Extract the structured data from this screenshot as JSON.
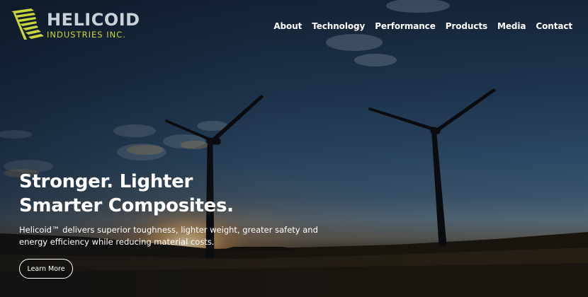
{
  "brand": {
    "name": "HELICOID",
    "tagline": "INDUSTRIES INC.",
    "logo_icon": "helicoid-logo-icon",
    "accent_color": "#c8d63c"
  },
  "nav": {
    "items": [
      {
        "label": "About"
      },
      {
        "label": "Technology"
      },
      {
        "label": "Performance"
      },
      {
        "label": "Products"
      },
      {
        "label": "Media"
      },
      {
        "label": "Contact"
      }
    ]
  },
  "hero": {
    "headline_line1": "Stronger. Lighter",
    "headline_line2": "Smarter Composites.",
    "body": "Helicoid™ delivers superior toughness, lighter weight, greater safety and energy efficiency while reducing material costs.",
    "cta_label": "Learn More",
    "background": "wind-turbines-sunset-photo"
  }
}
